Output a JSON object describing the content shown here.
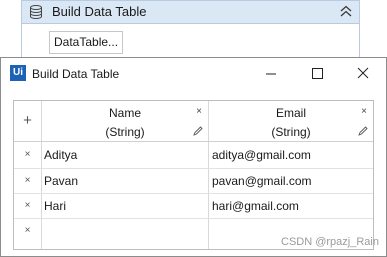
{
  "activity": {
    "title": "Build Data Table",
    "button_label": "DataTable..."
  },
  "dialog": {
    "title": "Build Data Table",
    "logo_text": "Ui"
  },
  "grid": {
    "add_symbol": "+",
    "delete_symbol": "×",
    "columns": [
      {
        "name": "Name",
        "type": "(String)"
      },
      {
        "name": "Email",
        "type": "(String)"
      }
    ],
    "rows": [
      {
        "name": "Aditya",
        "email": "aditya@gmail.com"
      },
      {
        "name": "Pavan",
        "email": "pavan@gmail.com"
      },
      {
        "name": "Hari",
        "email": "hari@gmail.com"
      },
      {
        "name": "",
        "email": ""
      }
    ]
  },
  "watermark": "CSDN @rpazj_Rain",
  "colors": {
    "header_blue": "#dae7f5",
    "logo_blue": "#1c63b7"
  }
}
